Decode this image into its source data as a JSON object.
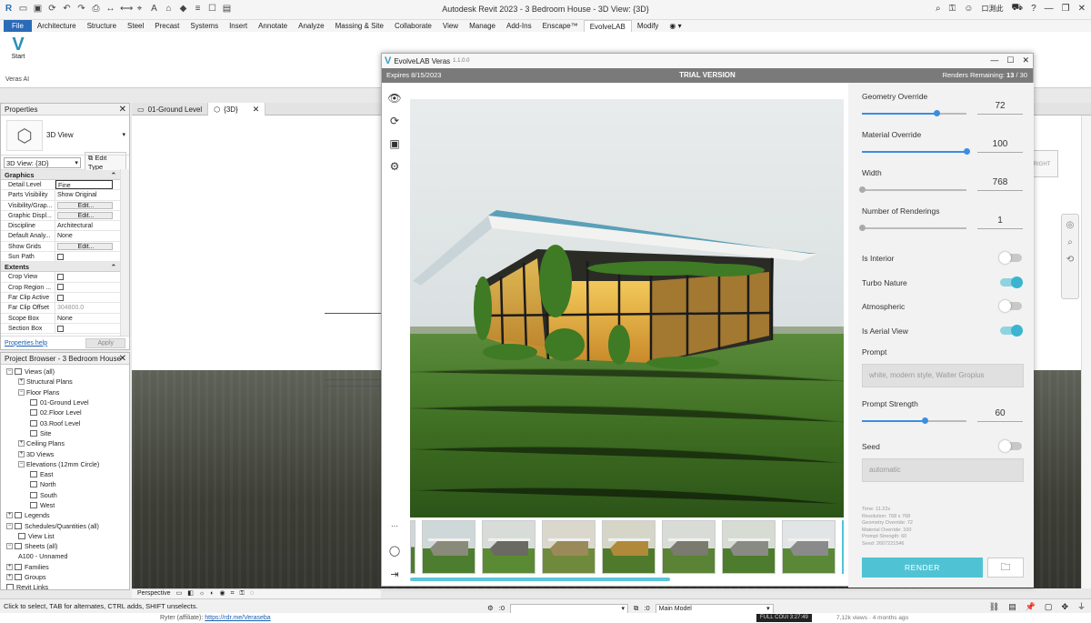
{
  "app_title": "Autodesk Revit 2023 - 3 Bedroom House - 3D View: {3D}",
  "title_right": {
    "user": "口測此"
  },
  "ribbon": {
    "tabs": [
      "File",
      "Architecture",
      "Structure",
      "Steel",
      "Precast",
      "Systems",
      "Insert",
      "Annotate",
      "Analyze",
      "Massing & Site",
      "Collaborate",
      "View",
      "Manage",
      "Add-Ins",
      "Enscape™",
      "EvolveLAB",
      "Modify"
    ],
    "active_tab": "EvolveLAB",
    "start_label": "Start",
    "group_label": "Veras AI"
  },
  "view_tabs": [
    {
      "label": "01-Ground Level",
      "icon": "floor-plan-icon"
    },
    {
      "label": "{3D}",
      "icon": "3d-view-icon"
    }
  ],
  "properties": {
    "header": "Properties",
    "type_name": "3D View",
    "view_selector": "3D View: {3D}",
    "edit_type": "Edit Type",
    "sections": [
      {
        "title": "Graphics",
        "rows": [
          {
            "k": "Detail Level",
            "v": "Fine",
            "kind": "boxed"
          },
          {
            "k": "Parts Visibility",
            "v": "Show Original",
            "kind": "text"
          },
          {
            "k": "Visibility/Grap...",
            "v": "Edit...",
            "kind": "btn"
          },
          {
            "k": "Graphic Displ...",
            "v": "Edit...",
            "kind": "btn"
          },
          {
            "k": "Discipline",
            "v": "Architectural",
            "kind": "text"
          },
          {
            "k": "Default Analy...",
            "v": "None",
            "kind": "text"
          },
          {
            "k": "Show Grids",
            "v": "Edit...",
            "kind": "btn"
          },
          {
            "k": "Sun Path",
            "v": "",
            "kind": "check"
          }
        ]
      },
      {
        "title": "Extents",
        "rows": [
          {
            "k": "Crop View",
            "v": "",
            "kind": "check"
          },
          {
            "k": "Crop Region ...",
            "v": "",
            "kind": "check"
          },
          {
            "k": "Far Clip Active",
            "v": "",
            "kind": "check"
          },
          {
            "k": "Far Clip Offset",
            "v": "304800.0",
            "kind": "grey"
          },
          {
            "k": "Scope Box",
            "v": "None",
            "kind": "text"
          },
          {
            "k": "Section Box",
            "v": "",
            "kind": "check"
          }
        ]
      }
    ],
    "help_link": "Properties help",
    "apply": "Apply"
  },
  "project_browser": {
    "header": "Project Browser - 3 Bedroom House",
    "tree": [
      {
        "label": "Views (all)",
        "depth": 0,
        "toggle": "−",
        "icon": true
      },
      {
        "label": "Structural Plans",
        "depth": 1,
        "toggle": "+"
      },
      {
        "label": "Floor Plans",
        "depth": 1,
        "toggle": "−"
      },
      {
        "label": "01-Ground Level",
        "depth": 2,
        "icon": true
      },
      {
        "label": "02.Floor Level",
        "depth": 2,
        "icon": true
      },
      {
        "label": "03.Roof Level",
        "depth": 2,
        "icon": true
      },
      {
        "label": "Site",
        "depth": 2,
        "icon": true
      },
      {
        "label": "Ceiling Plans",
        "depth": 1,
        "toggle": "+"
      },
      {
        "label": "3D Views",
        "depth": 1,
        "toggle": "+"
      },
      {
        "label": "Elevations (12mm Circle)",
        "depth": 1,
        "toggle": "−"
      },
      {
        "label": "East",
        "depth": 2,
        "icon": true
      },
      {
        "label": "North",
        "depth": 2,
        "icon": true
      },
      {
        "label": "South",
        "depth": 2,
        "icon": true
      },
      {
        "label": "West",
        "depth": 2,
        "icon": true
      },
      {
        "label": "Legends",
        "depth": 0,
        "toggle": "+",
        "icon": true
      },
      {
        "label": "Schedules/Quantities (all)",
        "depth": 0,
        "toggle": "−",
        "icon": true
      },
      {
        "label": "View List",
        "depth": 1,
        "icon": true
      },
      {
        "label": "Sheets (all)",
        "depth": 0,
        "toggle": "−",
        "icon": true
      },
      {
        "label": "A100 - Unnamed",
        "depth": 1
      },
      {
        "label": "Families",
        "depth": 0,
        "toggle": "+",
        "icon": true
      },
      {
        "label": "Groups",
        "depth": 0,
        "toggle": "+",
        "icon": true
      },
      {
        "label": "Revit Links",
        "depth": 0,
        "icon": true
      }
    ]
  },
  "view_control_bar": {
    "scale": "Perspective"
  },
  "status": {
    "message": "Click to select, TAB for alternates, CTRL adds, SHIFT unselects.",
    "workset_count": ":0",
    "model_select": "Main Model",
    "filter_count": ":0"
  },
  "bottom_strip": {
    "text": "Ryter (affiliate): ",
    "link": "https://rdr.me/Veraseba",
    "badge": "FULL COUI 3:27:49",
    "right": "7,12k views  ·  4 months ago"
  },
  "veras": {
    "title": "EvolveLAB Veras",
    "version": "1.1.0.0",
    "expires": "Expires 8/15/2023",
    "trial": "TRIAL VERSION",
    "renders_label": "Renders Remaining:",
    "renders_value": "13",
    "renders_total": "/ 30",
    "side_icons": [
      "eye-icon",
      "refresh-icon",
      "save-icon",
      "settings-icon"
    ],
    "sliders": [
      {
        "label": "Geometry Override",
        "value": "72",
        "fill": 0.72,
        "active": true
      },
      {
        "label": "Material Override",
        "value": "100",
        "fill": 1.0,
        "active": true
      },
      {
        "label": "Width",
        "value": "768",
        "fill": 0.0,
        "active": false
      },
      {
        "label": "Number of Renderings",
        "value": "1",
        "fill": 0.0,
        "active": false
      }
    ],
    "toggles": [
      {
        "label": "Is Interior",
        "on": false
      },
      {
        "label": "Turbo Nature",
        "on": true
      },
      {
        "label": "Atmospheric",
        "on": false
      },
      {
        "label": "Is Aerial View",
        "on": true
      }
    ],
    "prompt_label": "Prompt",
    "prompt_placeholder": "white, modern style, Walter Gropius",
    "prompt_strength": {
      "label": "Prompt Strength",
      "value": "60",
      "fill": 0.6
    },
    "seed_label": "Seed",
    "seed_on": false,
    "seed_placeholder": "automatic",
    "metadata": [
      "Time: 11.22s",
      "Resolution: 768 x 768",
      "Geometry Override: 72",
      "Material Override: 100",
      "Prompt Strength: 60",
      "Seed: 2607221546"
    ],
    "render_button": "RENDER",
    "progress": 0.6,
    "thumbnails": 8
  }
}
